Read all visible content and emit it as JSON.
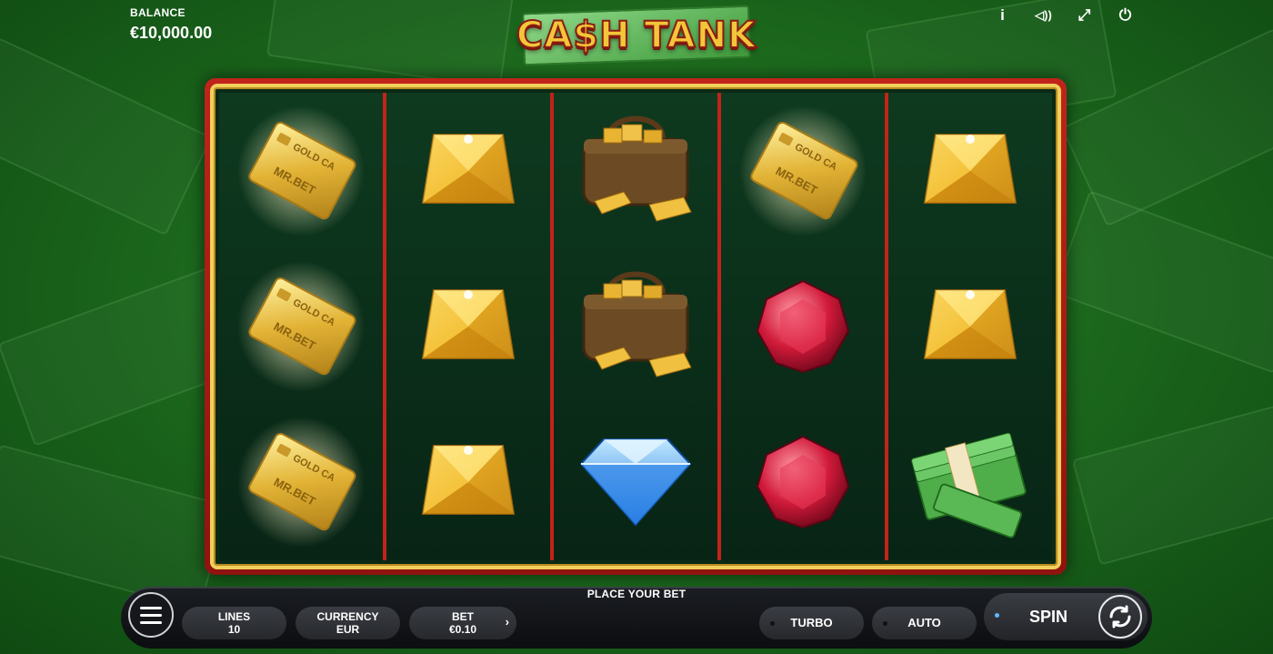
{
  "balance": {
    "label": "BALANCE",
    "value": "€10,000.00"
  },
  "logo": {
    "text": "CA$H TANK"
  },
  "top_icons": [
    "info-icon",
    "sound-icon",
    "fullscreen-icon",
    "power-icon"
  ],
  "top_icon_glyphs": [
    "i",
    "◁))",
    "⤢",
    "⏻"
  ],
  "reels": [
    [
      "gold-card",
      "gold-card",
      "gold-card"
    ],
    [
      "gold-gem",
      "gold-gem",
      "gold-gem"
    ],
    [
      "money-bag",
      "money-bag",
      "blue-diamond"
    ],
    [
      "gold-card",
      "ruby",
      "ruby"
    ],
    [
      "gold-gem",
      "gold-gem",
      "cash-stack"
    ]
  ],
  "card_text": {
    "line1": "GOLD CA",
    "line2": "MR.BET"
  },
  "status": "PLACE YOUR BET",
  "controls": {
    "lines": {
      "label": "LINES",
      "value": "10"
    },
    "currency": {
      "label": "CURRENCY",
      "value": "EUR"
    },
    "bet": {
      "label": "BET",
      "value": "€0.10"
    },
    "turbo": "TURBO",
    "auto": "AUTO",
    "spin": "SPIN"
  },
  "colors": {
    "frame_red": "#c0241a",
    "frame_gold": "#f1cf5b",
    "spin_dot": "#5bb8ff"
  }
}
